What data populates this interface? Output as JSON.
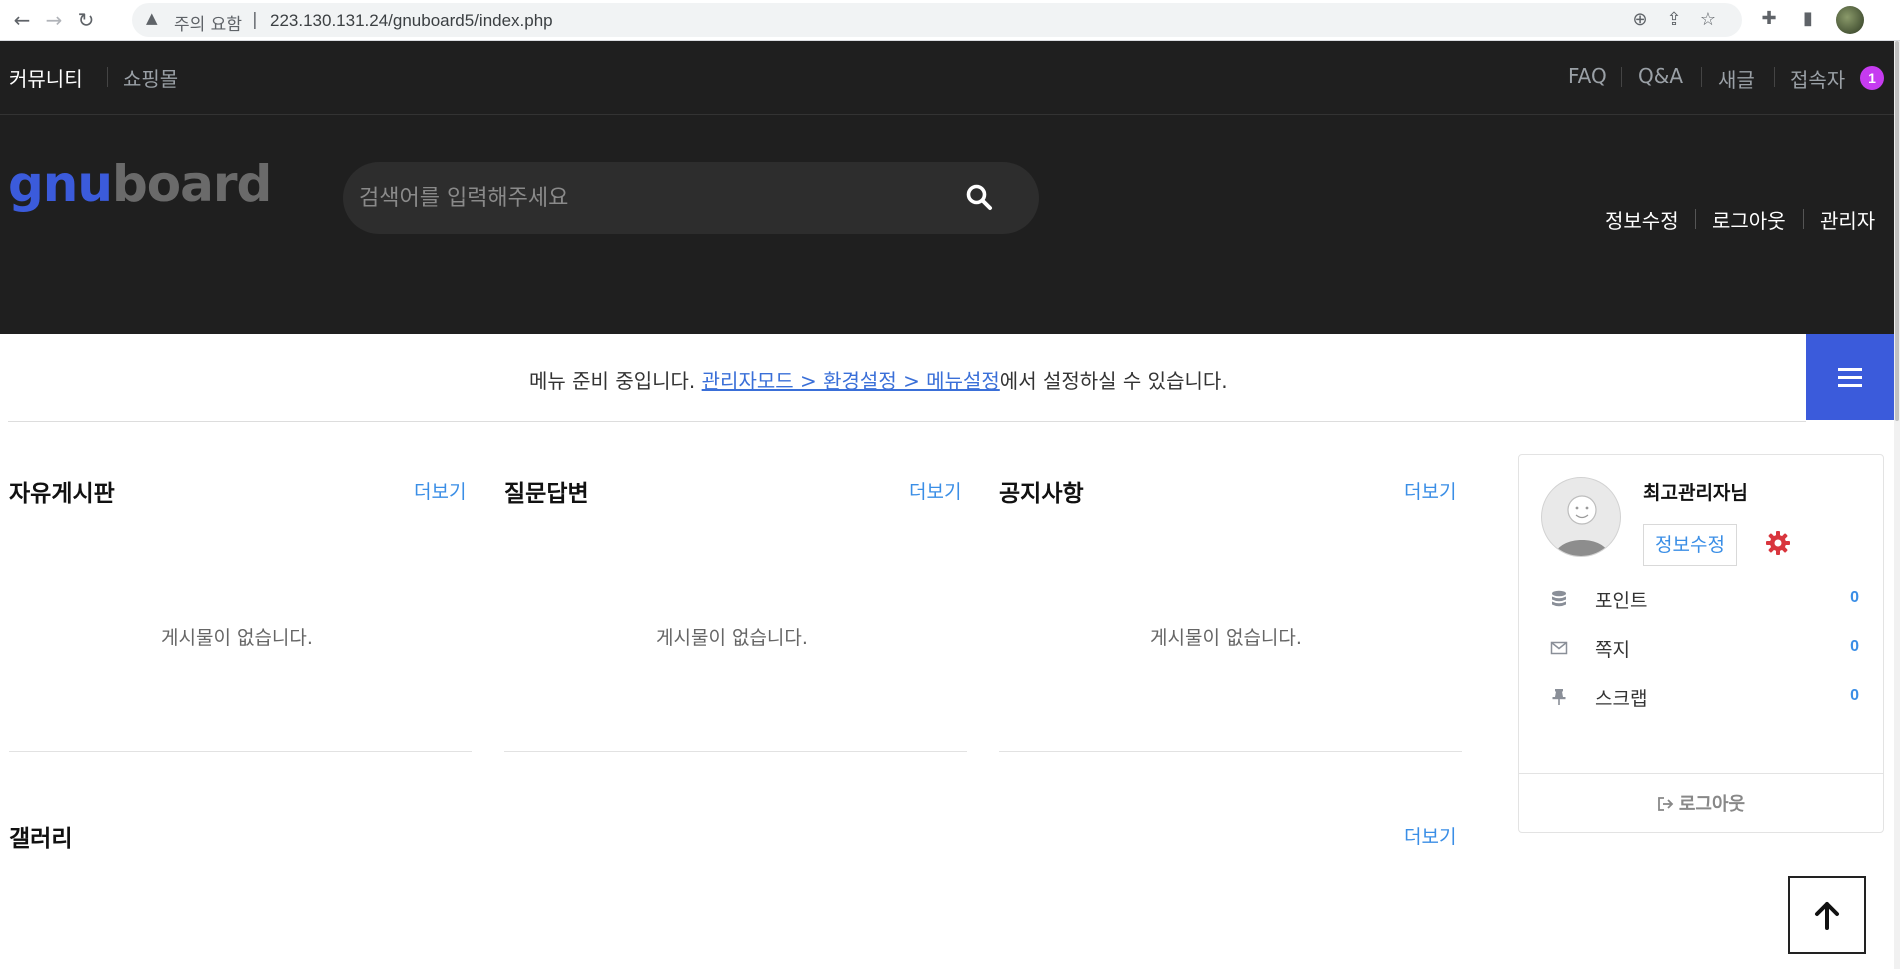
{
  "browser": {
    "back": "←",
    "forward": "→",
    "reload": "↻",
    "security_label": "주의 요함",
    "url": "223.130.131.24/gnuboard5/index.php"
  },
  "top_nav": {
    "left": [
      {
        "label": "커뮤니티",
        "active": true
      },
      {
        "label": "쇼핑몰",
        "active": false
      }
    ],
    "right": [
      {
        "label": "FAQ"
      },
      {
        "label": "Q&A"
      },
      {
        "label": "새글"
      },
      {
        "label": "접속자"
      }
    ],
    "visitor_count": "1"
  },
  "header": {
    "logo_gnu": "gnu",
    "logo_board": "board",
    "search_placeholder": "검색어를 입력해주세요",
    "links": [
      {
        "label": "정보수정"
      },
      {
        "label": "로그아웃"
      },
      {
        "label": "관리자"
      }
    ]
  },
  "menu": {
    "message_before": "메뉴 준비 중입니다. ",
    "message_link": "관리자모드 > 환경설정 > 메뉴설정",
    "message_after": "에서 설정하실 수 있습니다."
  },
  "boards": [
    {
      "title": "자유게시판",
      "more": "더보기",
      "empty": "게시물이 없습니다."
    },
    {
      "title": "질문답변",
      "more": "더보기",
      "empty": "게시물이 없습니다."
    },
    {
      "title": "공지사항",
      "more": "더보기",
      "empty": "게시물이 없습니다."
    }
  ],
  "gallery": {
    "title": "갤러리",
    "more": "더보기"
  },
  "profile": {
    "name": "최고관리자님",
    "edit_label": "정보수정",
    "rows": [
      {
        "label": "포인트",
        "value": "0",
        "icon": "database-icon"
      },
      {
        "label": "쪽지",
        "value": "0",
        "icon": "envelope-icon"
      },
      {
        "label": "스크랩",
        "value": "0",
        "icon": "thumbtack-icon"
      }
    ],
    "logout_label": "로그아웃"
  },
  "colors": {
    "header_bg": "#1f1f1f",
    "accent_blue": "#3b5bdb",
    "link_blue": "#3a8ee6",
    "badge_purple": "#c63bf0",
    "gear_red": "#d9363e"
  }
}
